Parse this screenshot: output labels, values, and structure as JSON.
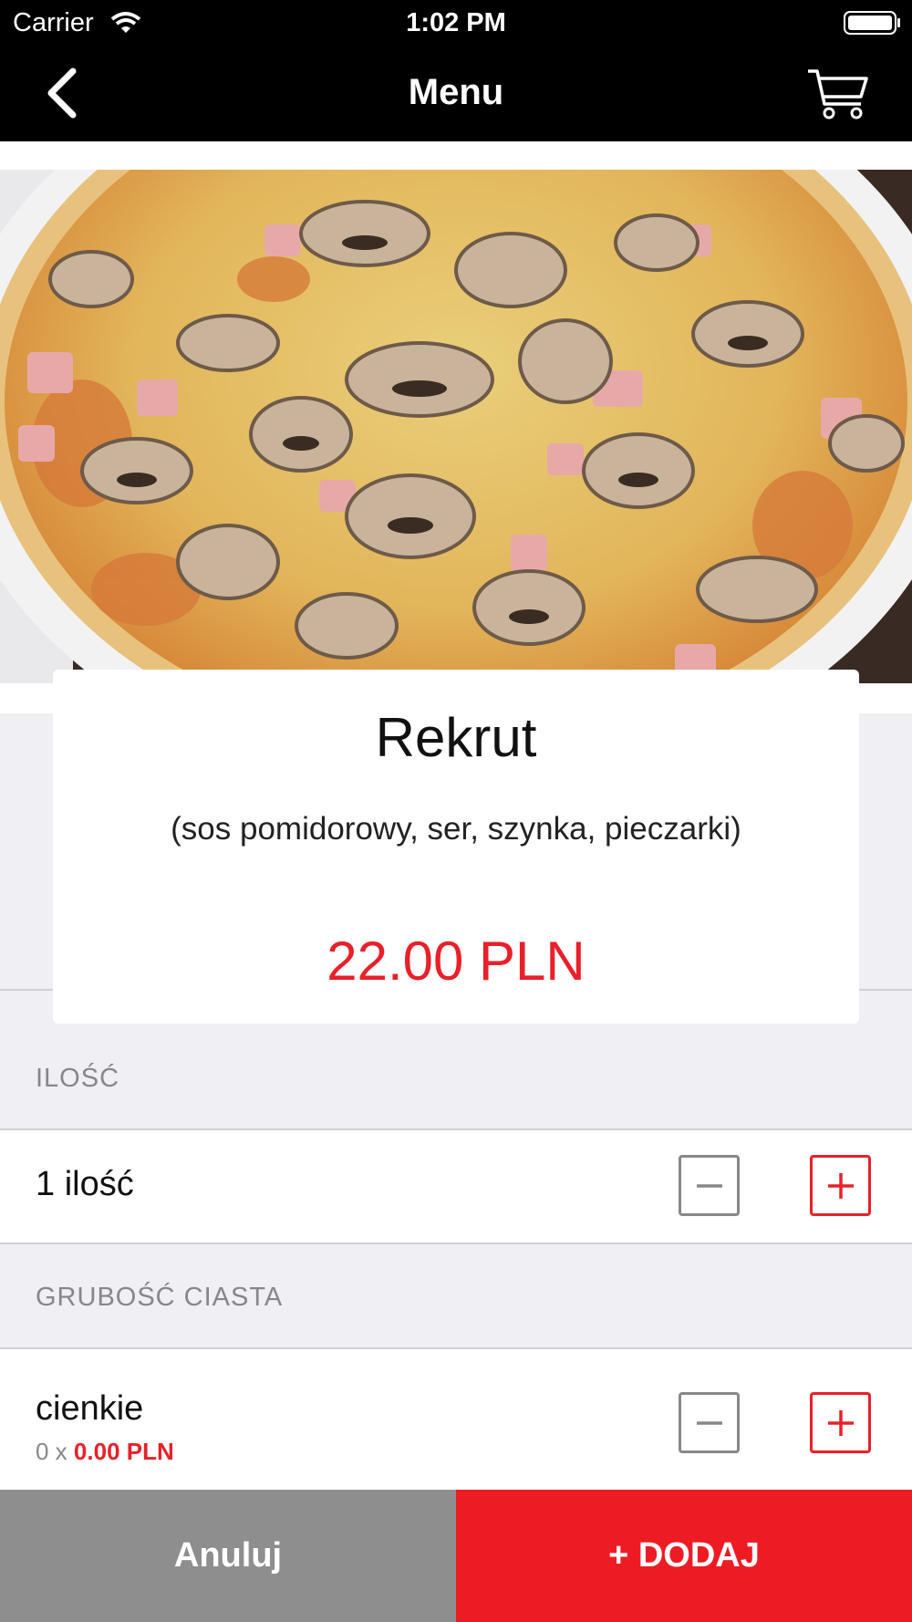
{
  "status_bar": {
    "carrier": "Carrier",
    "time": "1:02 PM"
  },
  "nav": {
    "title": "Menu",
    "back_icon": "chevron-left-icon",
    "cart_icon": "cart-icon"
  },
  "product": {
    "name": "Rekrut",
    "description": "(sos pomidorowy, ser, szynka, pieczarki)",
    "price": "22.00 PLN",
    "image": "pizza-photo"
  },
  "quantity_section": {
    "header": "ILOŚĆ",
    "label": "1 ilość"
  },
  "dough_section": {
    "header": "GRUBOŚĆ CIASTA",
    "option_label": "cienkie",
    "option_count": "0 x ",
    "option_price": "0.00 PLN"
  },
  "actions": {
    "cancel": "Anuluj",
    "add": "+ DODAJ"
  },
  "colors": {
    "accent": "#ed1c24",
    "cancel": "#8e8e8e",
    "header": "#000000"
  }
}
